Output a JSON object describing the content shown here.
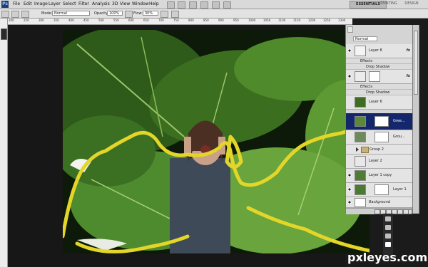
{
  "menubar": {
    "logo": "Ps",
    "items": [
      "File",
      "Edit",
      "Image",
      "Layer",
      "Select",
      "Filter",
      "Analysis",
      "3D",
      "View",
      "Window",
      "Help"
    ],
    "workspaces": {
      "essentials": "ESSENTIALS",
      "painting": "PAINTING",
      "design": "DESIGN"
    }
  },
  "options": {
    "mode_label": "Mode:",
    "mode_value": "Normal",
    "opacity_label": "Opacity:",
    "opacity_value": "100%",
    "flow_label": "Flow:",
    "flow_value": "30%"
  },
  "ruler": {
    "ticks": [
      "200",
      "250",
      "300",
      "350",
      "400",
      "450",
      "500",
      "550",
      "600",
      "650",
      "700",
      "750",
      "800",
      "850",
      "900",
      "950",
      "1000",
      "1050",
      "1100",
      "1150",
      "1200",
      "1250",
      "1300"
    ]
  },
  "layers_panel": {
    "blend_mode": "Normal",
    "layers": [
      {
        "name": "Layer 8",
        "fx": "fx",
        "visible": true,
        "effects_label": "Effects",
        "effect": "Drop Shadow"
      },
      {
        "name": "",
        "fx": "fx",
        "visible": true,
        "effects_label": "Effects",
        "effect": "Drop Shadow"
      },
      {
        "name": "Layer 6",
        "visible": false
      },
      {
        "name": "Gree...",
        "visible": false,
        "selected": true
      },
      {
        "name": "Grou...",
        "visible": false
      },
      {
        "name": "Group 2",
        "visible": false,
        "group": true
      },
      {
        "name": "Layer 2",
        "visible": false
      },
      {
        "name": "Layer 1 copy",
        "visible": true
      },
      {
        "name": "Layer 1",
        "visible": true
      },
      {
        "name": "Background",
        "visible": true
      }
    ]
  },
  "watermark": "pxleyes.com"
}
